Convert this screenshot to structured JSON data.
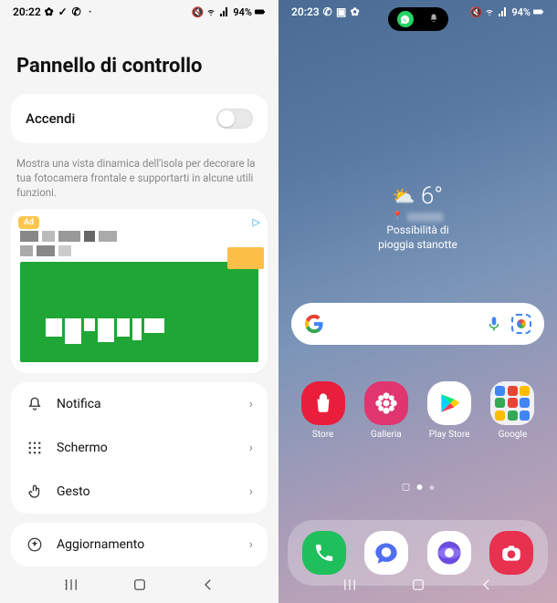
{
  "left": {
    "status": {
      "time": "20:22",
      "battery": "94%"
    },
    "title": "Pannello di controllo",
    "toggle": {
      "label": "Accendi"
    },
    "description": "Mostra una vista dinamica dell'isola per decorare la tua fotocamera frontale e supportarti in alcune utili funzioni.",
    "ad": {
      "badge": "Ad"
    },
    "menu": {
      "items": [
        {
          "label": "Notifica",
          "icon": "bell"
        },
        {
          "label": "Schermo",
          "icon": "grid"
        },
        {
          "label": "Gesto",
          "icon": "touch"
        }
      ],
      "update": {
        "label": "Aggiornamento",
        "icon": "star"
      }
    }
  },
  "right": {
    "status": {
      "time": "20:23",
      "battery": "94%"
    },
    "weather": {
      "temp": "6°",
      "desc_line1": "Possibilità di",
      "desc_line2": "pioggia stanotte"
    },
    "apps": {
      "row1": [
        {
          "label": "Store",
          "color": "#e91e3b",
          "icon": "bag"
        },
        {
          "label": "Galleria",
          "color": "#e0356f",
          "icon": "flower"
        },
        {
          "label": "Play Store",
          "color": "#fff",
          "icon": "play"
        },
        {
          "label": "Google",
          "color": "folder",
          "icon": "folder"
        }
      ],
      "dock": [
        {
          "color": "#1fbf5c",
          "icon": "phone"
        },
        {
          "color": "#ffffff",
          "icon": "chat"
        },
        {
          "color": "#6b4de0",
          "icon": "browser"
        },
        {
          "color": "#e8304f",
          "icon": "camera"
        }
      ]
    }
  }
}
